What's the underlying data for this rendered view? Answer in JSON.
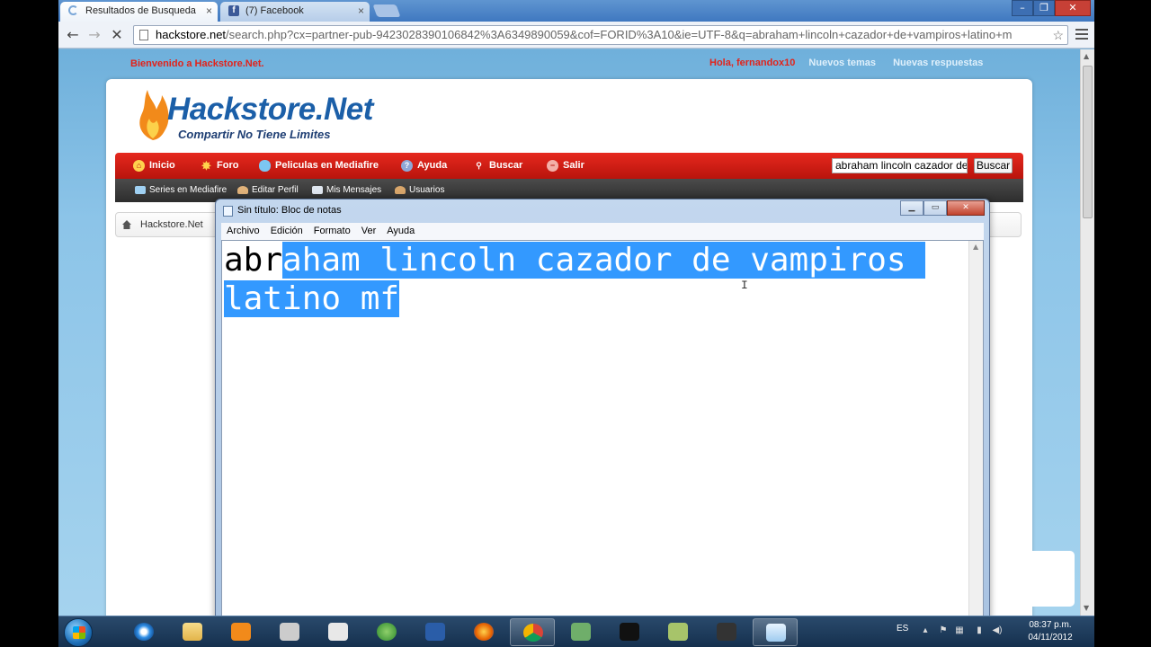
{
  "browser": {
    "tabs": [
      {
        "title": "Resultados de Busqueda",
        "close": "×"
      },
      {
        "title": "(7) Facebook",
        "close": "×"
      }
    ],
    "window_controls": {
      "minimize": "–",
      "maximize": "❐",
      "close": "✕"
    },
    "url_host": "hackstore.net",
    "url_path": "/search.php?cx=partner-pub-9423028390106842%3A6349890059&cof=FORID%3A10&ie=UTF-8&q=abraham+lincoln+cazador+de+vampiros+latino+m",
    "icons": {
      "back": "arrow-left-icon",
      "forward": "arrow-right-icon",
      "stop": "stop-icon",
      "star": "star-icon",
      "menu": "menu-icon"
    }
  },
  "site": {
    "welcome": "Bienvenido a Hackstore.Net.",
    "greeting": "Hola, fernandox10",
    "links": [
      "Nuevos temas",
      "Nuevas respuestas"
    ],
    "logo_title": "Hackstore.Net",
    "logo_subtitle": "Compartir No Tiene Limites",
    "main_nav": [
      "Inicio",
      "Foro",
      "Peliculas en Mediafire",
      "Ayuda",
      "Buscar",
      "Salir"
    ],
    "search_value": "abraham lincoln cazador de vampiros latino mf",
    "search_button": "Buscar",
    "sub_nav": [
      "Series en Mediafire",
      "Editar Perfil",
      "Mis Mensajes",
      "Usuarios"
    ],
    "breadcrumb": "Hackstore.Net"
  },
  "notepad": {
    "title": "Sin título: Bloc de notas",
    "menu": [
      "Archivo",
      "Edición",
      "Formato",
      "Ver",
      "Ayuda"
    ],
    "text_unselected": "abr",
    "text_selected": "aham lincoln cazador de vampiros latino mf"
  },
  "taskbar": {
    "language": "ES",
    "time": "08:37 p.m.",
    "date": "04/11/2012"
  },
  "colors": {
    "accent_red": "#e2231a",
    "logo_blue": "#1b5fa8",
    "selection": "#3399ff"
  }
}
